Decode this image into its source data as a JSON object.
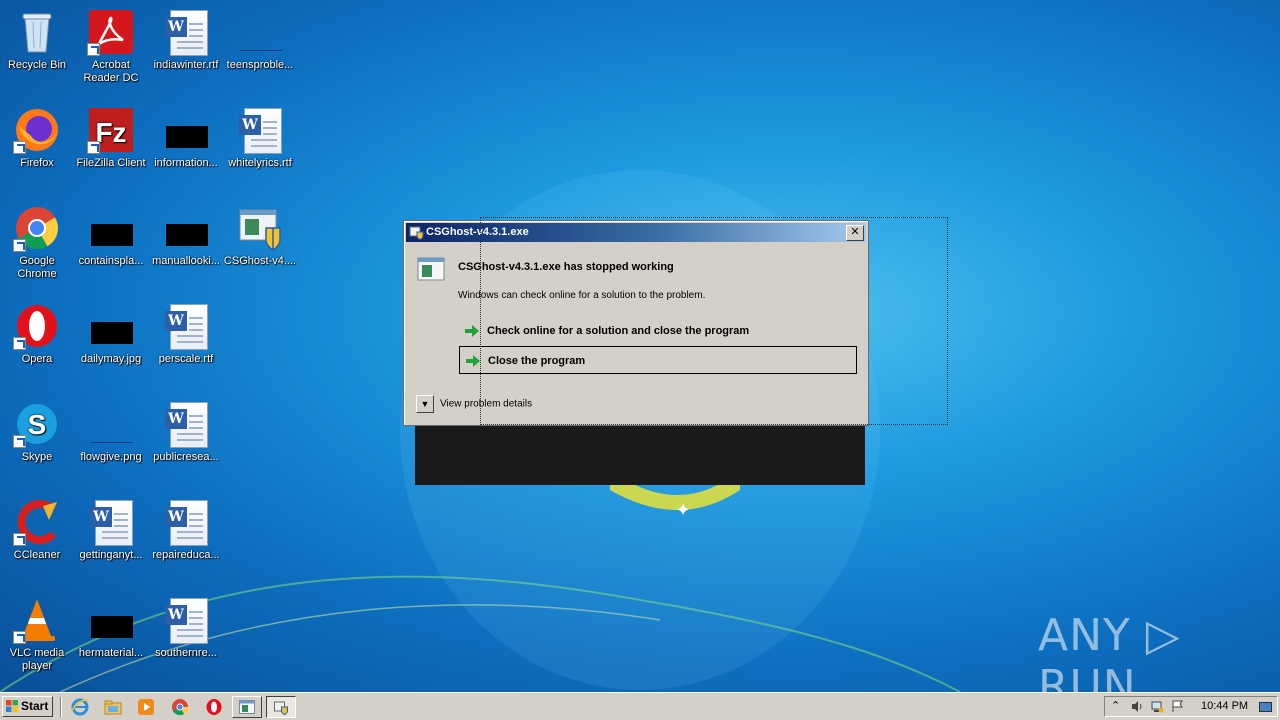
{
  "desktop": {
    "icons": [
      {
        "label": "Recycle Bin"
      },
      {
        "label": "Acrobat Reader DC"
      },
      {
        "label": "indiawinter.rtf"
      },
      {
        "label": "teensproble..."
      },
      {
        "label": "Firefox"
      },
      {
        "label": "FileZilla Client"
      },
      {
        "label": "information..."
      },
      {
        "label": "whitelyrics.rtf"
      },
      {
        "label": "Google Chrome"
      },
      {
        "label": "containspla..."
      },
      {
        "label": "manuallooki..."
      },
      {
        "label": "CSGhost-v4...."
      },
      {
        "label": "Opera"
      },
      {
        "label": "dailymay.jpg"
      },
      {
        "label": "perscale.rtf"
      },
      {
        "label": "Skype"
      },
      {
        "label": "flowgive.png"
      },
      {
        "label": "publicresea..."
      },
      {
        "label": "CCleaner"
      },
      {
        "label": "gettinganyt..."
      },
      {
        "label": "repaireduca..."
      },
      {
        "label": "VLC media player"
      },
      {
        "label": "hermaterial..."
      },
      {
        "label": "southernre..."
      }
    ]
  },
  "dialog": {
    "title": "CSGhost-v4.3.1.exe",
    "heading": "CSGhost-v4.3.1.exe has stopped working",
    "subtext": "Windows can check online for a solution to the problem.",
    "option_check_online": "Check online for a solution and close the program",
    "option_close": "Close the program",
    "details_label": "View problem details",
    "close_glyph": "✕"
  },
  "taskbar": {
    "start_label": "Start",
    "clock": "10:44 PM",
    "tray_arrow": "⌃"
  },
  "watermark": {
    "text": "ANY ▷ RUN"
  },
  "colors": {
    "titlebar_start": "#0a246a",
    "titlebar_end": "#a6caf0",
    "dialog_bg": "#d4d0c8",
    "arrow_green": "#1fa33a"
  }
}
